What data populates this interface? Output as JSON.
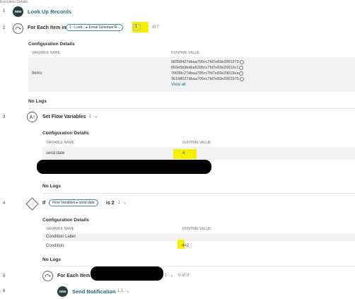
{
  "top_label": "Execution Details",
  "steps": [
    {
      "number": "1",
      "title": "Look Up Records",
      "icon": "now-logo-icon"
    },
    {
      "number": "2",
      "title": "For Each Item in",
      "pill": "1 - Look... ▸ Email Schedule R...",
      "counter_value": "1",
      "counter_total": "of 7",
      "icon": "loop-icon",
      "config_title": "Configuration Details",
      "col_variable": "VARIABLE NAME",
      "col_runtime": "RUNTIME VALUE",
      "row_name": "Items",
      "values": [
        "08398427dbaa795cc7fd7e83e2961970",
        "893e5b9bdba6395cc7fd7e83e29619c1",
        "70698c27dbaa795cc7fd7e83e29619ea",
        "36198027dbaa795cc7fd7e83e2961975"
      ],
      "view_all": "View all",
      "no_logs": "No Logs"
    },
    {
      "number": "3",
      "title": "Set Flow Variables",
      "suffix": "1 ◌ₐ",
      "icon": "set-variable-icon",
      "config_title": "Configuration Details",
      "col_variable": "VARIABLE NAME",
      "col_runtime": "RUNTIME VALUE",
      "row_name": "send date",
      "row_value": "4",
      "no_logs": "No Logs"
    },
    {
      "number": "4",
      "title": "If",
      "pill": "Flow Variables ▸ send date",
      "condition": "is 2",
      "suffix": "1 ◌ₐ",
      "icon": "decision-icon",
      "config_title": "Configuration Details",
      "col_variable": "VARIABLE NAME",
      "col_runtime": "RUNTIME VALUE",
      "row1_name": "Condition Label",
      "row2_name": "Condition",
      "row2_value": "4=2",
      "no_logs": "No Logs"
    },
    {
      "number": "5",
      "title": "For Each Item in",
      "suffix": "1 ◌ₐ",
      "counter": "0 of 0",
      "icon": "loop-icon"
    },
    {
      "number": "6",
      "title": "Send Notification",
      "suffix": "1.1 ◌ₐ",
      "icon": "now-logo-icon"
    }
  ],
  "colors": {
    "link": "#1f6f8b",
    "highlight": "#f7ef00",
    "pill_border": "#3a8ea3",
    "now_badge": "#293e40"
  }
}
